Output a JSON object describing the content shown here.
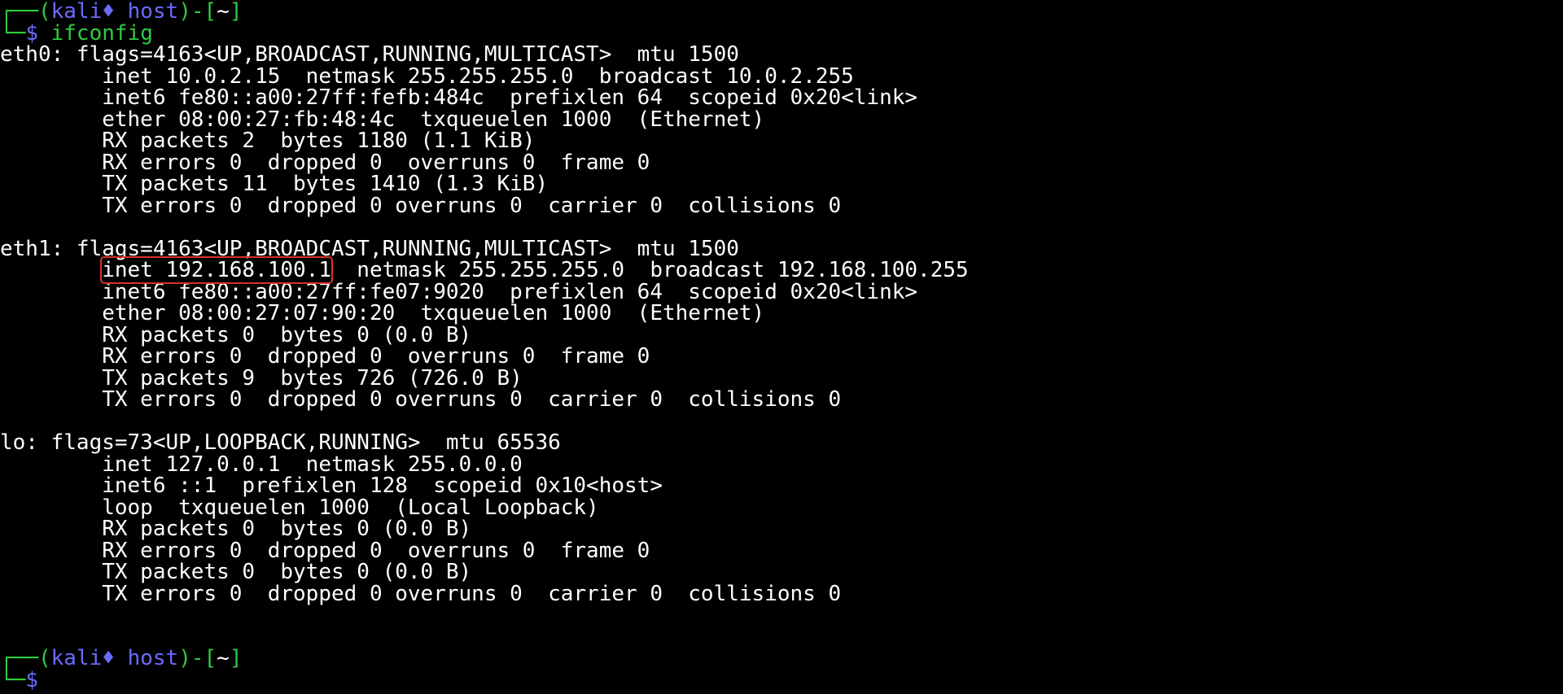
{
  "prompt": {
    "box_top": "┌──(",
    "user": "kali",
    "separator": "♦",
    "host": "host",
    "path_open": ")-[",
    "path": "~",
    "path_close": "]",
    "box_bottom": "└─",
    "dollar": "$"
  },
  "command": "ifconfig",
  "output": {
    "eth0": {
      "header": "eth0: flags=4163<UP,BROADCAST,RUNNING,MULTICAST>  mtu 1500",
      "lines": [
        "        inet 10.0.2.15  netmask 255.255.255.0  broadcast 10.0.2.255",
        "        inet6 fe80::a00:27ff:fefb:484c  prefixlen 64  scopeid 0x20<link>",
        "        ether 08:00:27:fb:48:4c  txqueuelen 1000  (Ethernet)",
        "        RX packets 2  bytes 1180 (1.1 KiB)",
        "        RX errors 0  dropped 0  overruns 0  frame 0",
        "        TX packets 11  bytes 1410 (1.3 KiB)",
        "        TX errors 0  dropped 0 overruns 0  carrier 0  collisions 0"
      ]
    },
    "eth1": {
      "header": "eth1: flags=4163<UP,BROADCAST,RUNNING,MULTICAST>  mtu 1500",
      "inet_indent": "        ",
      "inet_highlight": "inet 192.168.100.1",
      "inet_rest": "  netmask 255.255.255.0  broadcast 192.168.100.255",
      "lines": [
        "        inet6 fe80::a00:27ff:fe07:9020  prefixlen 64  scopeid 0x20<link>",
        "        ether 08:00:27:07:90:20  txqueuelen 1000  (Ethernet)",
        "        RX packets 0  bytes 0 (0.0 B)",
        "        RX errors 0  dropped 0  overruns 0  frame 0",
        "        TX packets 9  bytes 726 (726.0 B)",
        "        TX errors 0  dropped 0 overruns 0  carrier 0  collisions 0"
      ]
    },
    "lo": {
      "header": "lo: flags=73<UP,LOOPBACK,RUNNING>  mtu 65536",
      "lines": [
        "        inet 127.0.0.1  netmask 255.0.0.0",
        "        inet6 ::1  prefixlen 128  scopeid 0x10<host>",
        "        loop  txqueuelen 1000  (Local Loopback)",
        "        RX packets 0  bytes 0 (0.0 B)",
        "        RX errors 0  dropped 0  overruns 0  frame 0",
        "        TX packets 0  bytes 0 (0.0 B)",
        "        TX errors 0  dropped 0 overruns 0  carrier 0  collisions 0"
      ]
    }
  },
  "colors": {
    "background": "#000000",
    "text": "#ffffff",
    "prompt_green": "#2ecc40",
    "prompt_blue": "#6a6aff",
    "highlight_box": "#d9302b"
  }
}
